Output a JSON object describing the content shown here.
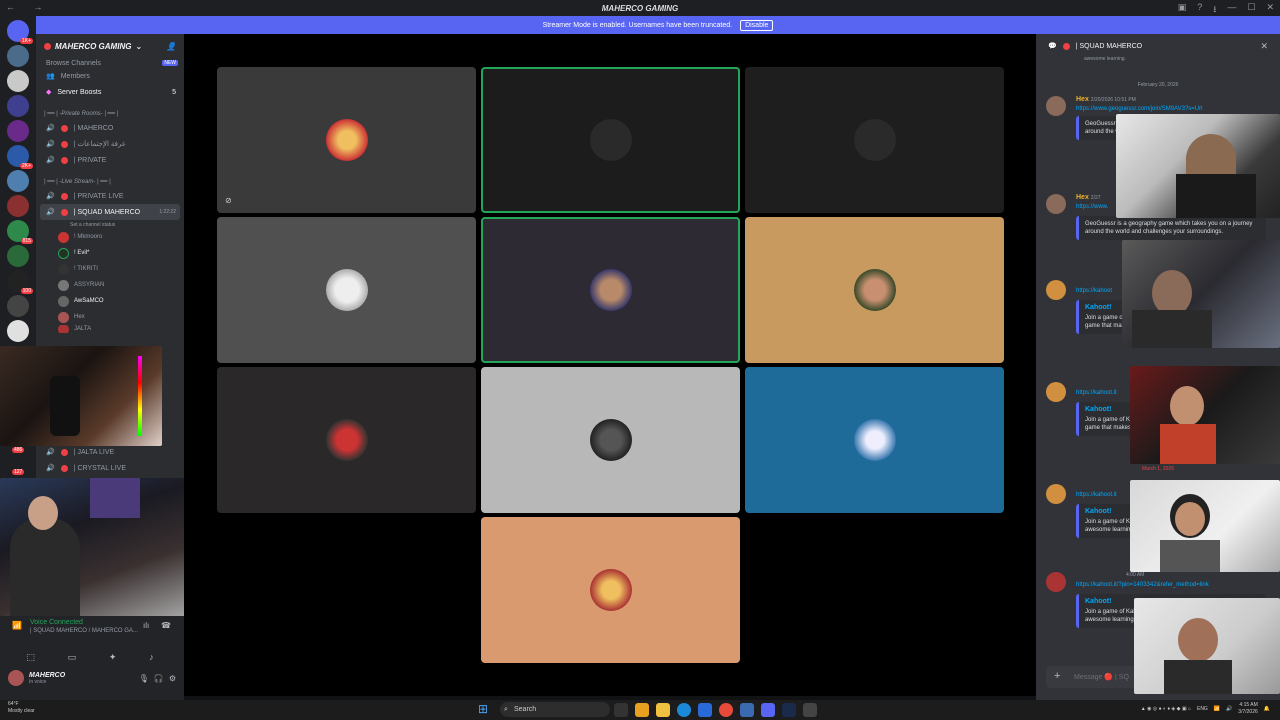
{
  "window": {
    "title": "MAHERCO GAMING",
    "nav_icons": "← →"
  },
  "banner": {
    "text": "Streamer Mode is enabled. Usernames have been truncated.",
    "button": "Disable"
  },
  "server_badges": [
    "1K+",
    "2K+",
    "815",
    "100"
  ],
  "sidebar": {
    "guild_name": "MAHERCO GAMING",
    "top_items": [
      {
        "label": "Browse Channels",
        "badge": "NEW"
      },
      {
        "label": "Members",
        "badge": ""
      },
      {
        "label": "Server Boosts",
        "badge": "5"
      }
    ],
    "cat_private": "| ━━ | -Private Rooms- | ━━ |",
    "private_channels": [
      "| MAHERCO",
      "| غرفة الإجتماعات",
      "| PRIVATE"
    ],
    "cat_live": "| ━━ | -Live Stream- | ━━ |",
    "live_channels": [
      "| PRIVATE LIVE"
    ],
    "active_channel": "| SQUAD MAHERCO",
    "active_time": "1:22:22",
    "active_status": "Set a channel status",
    "voice_users": [
      "! Mkmooro",
      "! Evil*",
      "! TIKRITI",
      "ASSYRIAN",
      "AwSaMCO",
      "Hex",
      "JALTA"
    ],
    "more_channels": [
      "| JALTA LIVE",
      "| CRYSTAL LIVE"
    ],
    "more_badges": [
      "486",
      "127"
    ]
  },
  "voice": {
    "connected": "Voice Connected",
    "channel": "| SQUAD MAHERCO / MAHERCO GA..."
  },
  "user": {
    "name": "MAHERCO",
    "status": "In voice"
  },
  "chat": {
    "channel": "| SQUAD MAHERCO",
    "top_snippet": "awesome learning.",
    "date1": "February 20, 2026",
    "msg1": {
      "author": "Hex",
      "time": "2/20/2026 10:51 PM",
      "link": "https://www.geoguessr.com/join/SM9AV3?s=Url",
      "desc": "GeoGuessr is a geography game which takes you on a journey around the world and challenges your surroundings."
    },
    "msg2": {
      "author": "Hex",
      "time": "2/27",
      "link": "https://www.",
      "desc": "GeoGuessr is a geography game which takes you on a journey around the world and challenges your surroundings."
    },
    "msg3": {
      "link": "https://kahoot",
      "title": "Kahoot!",
      "desc": "Join a game of Kahoot here! Kahoot! is a free interactive quiz game that makes awesome learning."
    },
    "msg4": {
      "link": "https://kahoot.it",
      "title": "Kahoot!",
      "desc": "Join a game of Kahoot here! Kahoot! is a free interactive quiz game that makes awesome learning."
    },
    "date2": "March 1, 2026",
    "msg5": {
      "link": "https://kahoot.it",
      "title": "Kahoot!",
      "desc": "Join a game of Kahoot here! Kahoot! is a free interactive quiz, awesome learning."
    },
    "msg6": {
      "time": "4:00 AM",
      "link": "https://kahoot.it/?pin=1403342&refer_method=link",
      "title": "Kahoot!",
      "desc": "Join a game of Kahoot here! Kahoot! is a free interactive quiz, awesome learning."
    },
    "input_placeholder": "Message 🔴 | SQ"
  },
  "taskbar": {
    "temp": "64°F",
    "weather": "Mostly clear",
    "search": "Search",
    "lang": "ENG",
    "time": "4:15 AM",
    "date": "3/7/2026"
  }
}
